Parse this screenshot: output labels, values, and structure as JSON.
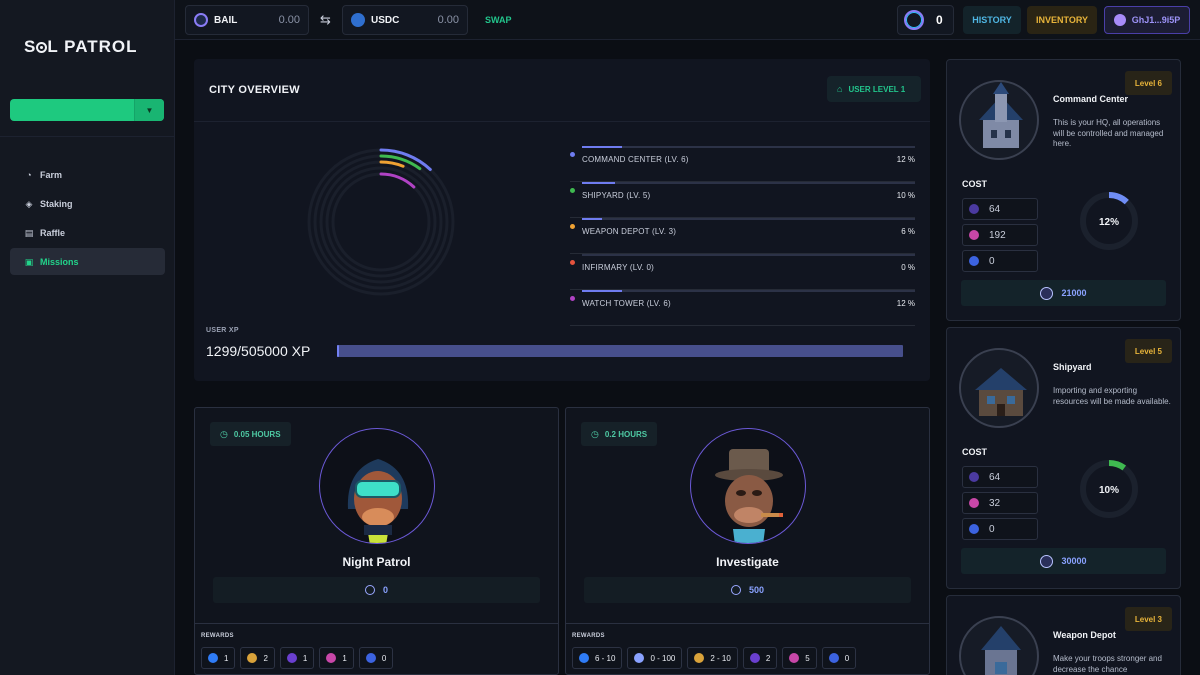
{
  "sidebar": {
    "logo": "S",
    "logo_rest": "L PATROL",
    "nav": [
      {
        "label": "Farm",
        "icon": "pie-chart-icon"
      },
      {
        "label": "Staking",
        "icon": "staking-icon"
      },
      {
        "label": "Raffle",
        "icon": "ticket-icon"
      },
      {
        "label": "Missions",
        "icon": "missions-icon"
      }
    ]
  },
  "topbar": {
    "from_token": {
      "name": "BAIL",
      "amount": "0.00"
    },
    "to_token": {
      "name": "USDC",
      "amount": "0.00"
    },
    "swap_label": "SWAP",
    "counter": "0",
    "history": "HISTORY",
    "inventory": "INVENTORY",
    "account": "GhJ1...9i5P"
  },
  "overview": {
    "title": "CITY OVERVIEW",
    "user_level": "USER LEVEL 1",
    "buildings": [
      {
        "name": "COMMAND CENTER (LV. 6)",
        "percent": "12 %",
        "value": 12,
        "color": "#6f7cf0"
      },
      {
        "name": "SHIPYARD (LV. 5)",
        "percent": "10 %",
        "value": 10,
        "color": "#3fb950"
      },
      {
        "name": "WEAPON DEPOT (LV. 3)",
        "percent": "6 %",
        "value": 6,
        "color": "#f0a233"
      },
      {
        "name": "INFIRMARY (LV. 0)",
        "percent": "0 %",
        "value": 0,
        "color": "#e5533d"
      },
      {
        "name": "WATCH TOWER (LV. 6)",
        "percent": "12 %",
        "value": 12,
        "color": "#b042c4"
      }
    ],
    "xp_label": "USER XP",
    "xp_value": "1299/505000 XP",
    "xp_progress": 0.003
  },
  "missions": [
    {
      "duration": "0.05 HOURS",
      "name": "Night Patrol",
      "cost": "0",
      "rewards_label": "REWARDS",
      "rewards": [
        {
          "icon": "xp-icon",
          "value": "1",
          "color": "#2f7cf6"
        },
        {
          "icon": "rainbow-gem-icon",
          "value": "2",
          "color": "#d9a23a"
        },
        {
          "icon": "purple-orb-icon",
          "value": "1",
          "color": "#6a3fcf"
        },
        {
          "icon": "pink-gem-icon",
          "value": "1",
          "color": "#c847a8"
        },
        {
          "icon": "blue-shard-icon",
          "value": "0",
          "color": "#3c63e0"
        }
      ]
    },
    {
      "duration": "0.2 HOURS",
      "name": "Investigate",
      "cost": "500",
      "rewards_label": "REWARDS",
      "rewards": [
        {
          "icon": "xp-icon",
          "value": "6 - 10",
          "color": "#2f7cf6"
        },
        {
          "icon": "coin-icon",
          "value": "0 - 100",
          "color": "#8aa2ff"
        },
        {
          "icon": "rainbow-gem-icon",
          "value": "2 - 10",
          "color": "#d9a23a"
        },
        {
          "icon": "purple-orb-icon",
          "value": "2",
          "color": "#6a3fcf"
        },
        {
          "icon": "pink-gem-icon",
          "value": "5",
          "color": "#c847a8"
        },
        {
          "icon": "blue-shard-icon",
          "value": "0",
          "color": "#3c63e0"
        }
      ]
    }
  ],
  "buildings": [
    {
      "level": "Level 6",
      "name": "Command Center",
      "desc": "This is your HQ, all operations will be controlled and managed here.",
      "cost_label": "COST",
      "costs": [
        "64",
        "192",
        "0"
      ],
      "percent": "12%",
      "progress": 0.12,
      "ring_color": "#6f8df5",
      "upgrade": "21000"
    },
    {
      "level": "Level 5",
      "name": "Shipyard",
      "desc": "Importing and exporting resources will be made available.",
      "cost_label": "COST",
      "costs": [
        "64",
        "32",
        "0"
      ],
      "percent": "10%",
      "progress": 0.1,
      "ring_color": "#3fb950",
      "upgrade": "30000"
    },
    {
      "level": "Level 3",
      "name": "Weapon Depot",
      "desc": "Make your troops stronger and decrease the chance"
    }
  ]
}
